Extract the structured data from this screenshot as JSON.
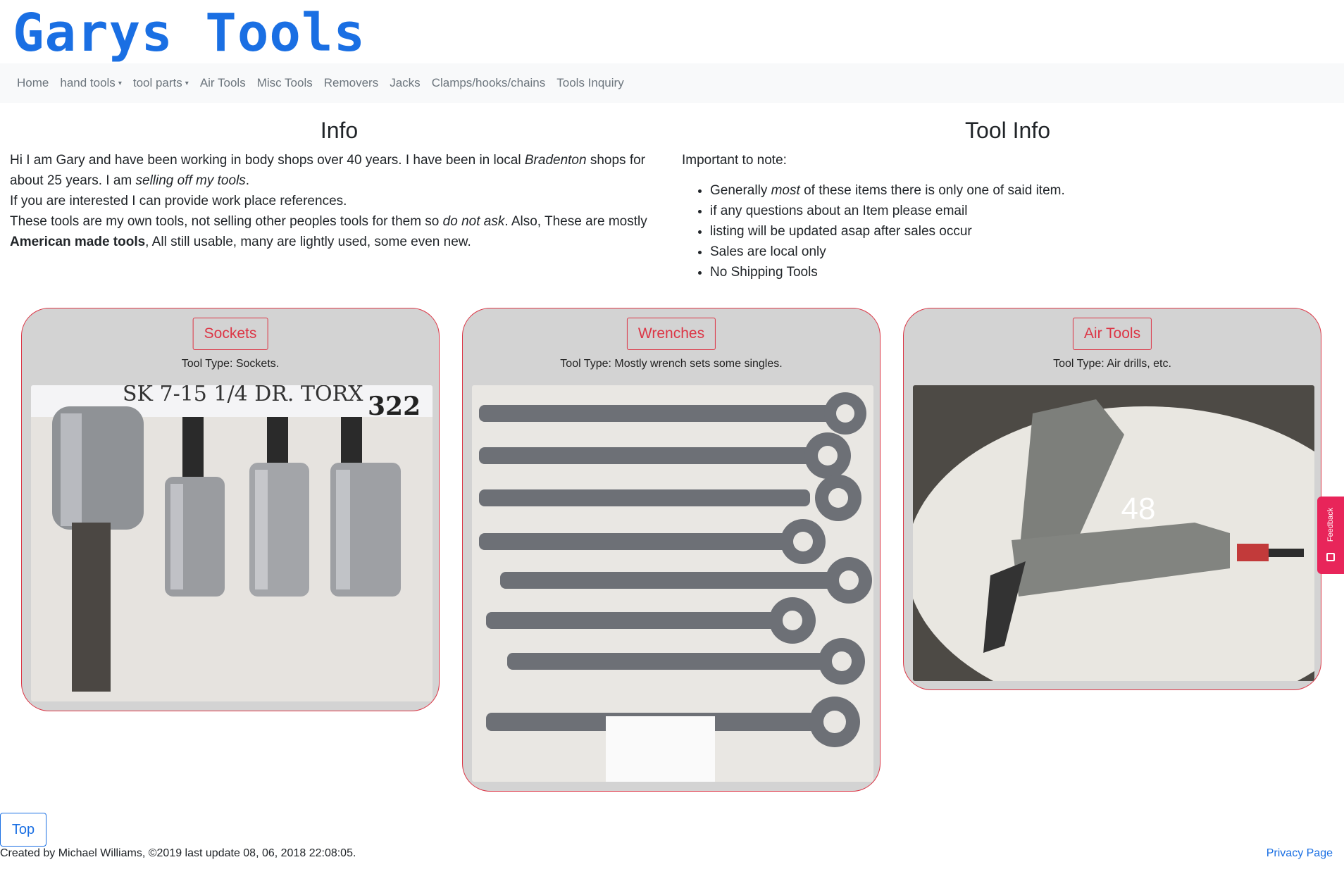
{
  "header": {
    "logo": "Garys Tools"
  },
  "nav": {
    "items": [
      {
        "label": "Home",
        "dropdown": false
      },
      {
        "label": "hand tools",
        "dropdown": true
      },
      {
        "label": "tool parts",
        "dropdown": true
      },
      {
        "label": "Air Tools",
        "dropdown": false
      },
      {
        "label": "Misc Tools",
        "dropdown": false
      },
      {
        "label": "Removers",
        "dropdown": false
      },
      {
        "label": "Jacks",
        "dropdown": false
      },
      {
        "label": "Clamps/hooks/chains",
        "dropdown": false
      },
      {
        "label": "Tools Inquiry",
        "dropdown": false
      }
    ]
  },
  "info": {
    "title": "Info",
    "p1_a": "Hi I am Gary and have been working in body shops over 40 years. I have been in local ",
    "p1_em": "Bradenton",
    "p1_b": " shops for about 25 years. I am ",
    "p1_em2": "selling off my tools",
    "p1_c": ".",
    "p2": "If you are interested I can provide work place references.",
    "p3_a": "These tools are my own tools, not selling other peoples tools for them so ",
    "p3_em": "do not ask",
    "p3_b": ". Also, These are mostly ",
    "p3_strong": "American made tools",
    "p3_c": ", All still usable, many are lightly used, some even new."
  },
  "tool_info": {
    "title": "Tool Info",
    "intro": "Important to note:",
    "item1_a": "Generally ",
    "item1_em": "most",
    "item1_b": " of these items there is only one of said item.",
    "item2": "if any questions about an Item please email",
    "item3": "listing will be updated asap after sales occur",
    "item4": "Sales are local only",
    "item5": "No Shipping Tools"
  },
  "cards": [
    {
      "button": "Sockets",
      "type": "Tool Type: Sockets.",
      "photo_text": "SK 7-15  1/4 DR. TORX",
      "photo_num": "322"
    },
    {
      "button": "Wrenches",
      "type": "Tool Type: Mostly wrench sets some singles."
    },
    {
      "button": "Air Tools",
      "type": "Tool Type: Air drills, etc.",
      "photo_num": "48"
    }
  ],
  "footer": {
    "top": "Top",
    "credit": "Created by Michael Williams, ©2019 last update 08, 06, 2018 22:08:05.",
    "privacy": "Privacy Page",
    "feedback": "Feedback"
  },
  "colors": {
    "accent": "#dc3545",
    "brand": "#1a6fe3",
    "feedback": "#e8255a"
  }
}
